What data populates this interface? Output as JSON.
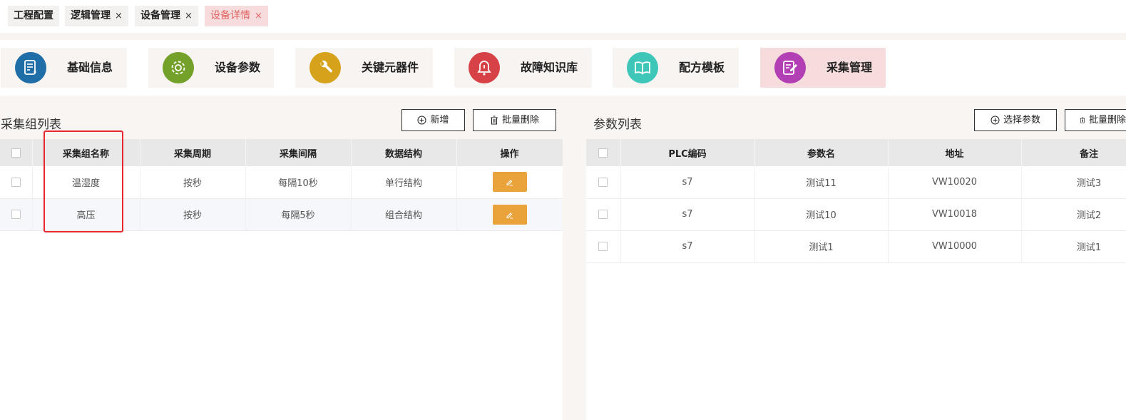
{
  "tabs": [
    {
      "label": "工程配置",
      "closable": false
    },
    {
      "label": "逻辑管理",
      "closable": true
    },
    {
      "label": "设备管理",
      "closable": true
    },
    {
      "label": "设备详情",
      "closable": true,
      "active": true
    }
  ],
  "close_glyph": "×",
  "modules": [
    {
      "label": "基础信息",
      "icon": "document-icon",
      "color": "#1f6ea8"
    },
    {
      "label": "设备参数",
      "icon": "gear-icon",
      "color": "#74a12a"
    },
    {
      "label": "关键元器件",
      "icon": "wrench-icon",
      "color": "#d6a21b"
    },
    {
      "label": "故障知识库",
      "icon": "bell-icon",
      "color": "#d64246"
    },
    {
      "label": "配方模板",
      "icon": "book-icon",
      "color": "#3ec6b9"
    },
    {
      "label": "采集管理",
      "icon": "edit-icon",
      "color": "#b33fb5",
      "active": true
    }
  ],
  "left_panel": {
    "title": "采集组列表",
    "add_button": "新增",
    "batch_delete_button": "批量删除",
    "columns": [
      "采集组名称",
      "采集周期",
      "采集间隔",
      "数据结构",
      "操作"
    ],
    "rows": [
      [
        "温湿度",
        "按秒",
        "每隔10秒",
        "单行结构"
      ],
      [
        "高压",
        "按秒",
        "每隔5秒",
        "组合结构"
      ]
    ]
  },
  "right_panel": {
    "title": "参数列表",
    "select_button": "选择参数",
    "batch_delete_button": "批量删除",
    "columns": [
      "PLC编码",
      "参数名",
      "地址",
      "备注"
    ],
    "rows": [
      [
        "s7",
        "测试11",
        "VW10020",
        "测试3"
      ],
      [
        "s7",
        "测试10",
        "VW10018",
        "测试2"
      ],
      [
        "s7",
        "测试1",
        "VW10000",
        "测试1"
      ]
    ]
  },
  "colors": {
    "accent_active_tab_text": "#e06565",
    "active_bg": "#f6dcdc",
    "edit_button": "#e9a33a",
    "highlight_box": "#e8262d"
  }
}
